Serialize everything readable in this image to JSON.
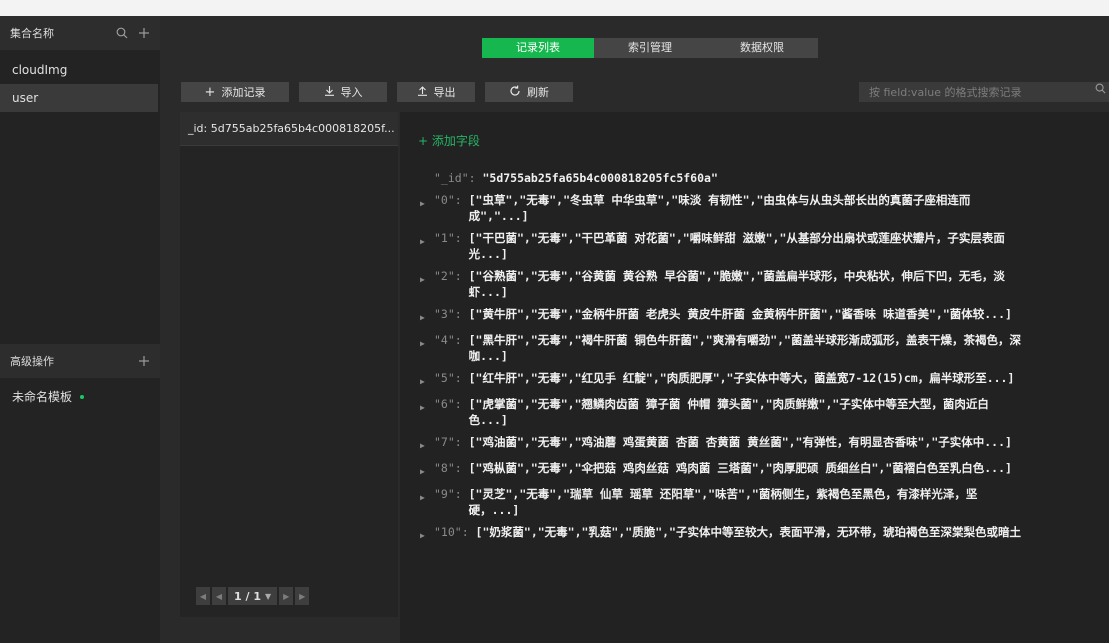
{
  "sidebar": {
    "collections_title": "集合名称",
    "collections": [
      {
        "name": "cloudImg",
        "active": false
      },
      {
        "name": "user",
        "active": true
      }
    ],
    "advanced_title": "高级操作",
    "template_name": "未命名模板"
  },
  "tabs": [
    {
      "label": "记录列表",
      "active": true
    },
    {
      "label": "索引管理",
      "active": false
    },
    {
      "label": "数据权限",
      "active": false
    }
  ],
  "toolbar": {
    "add_record": "添加记录",
    "import": "导入",
    "export": "导出",
    "refresh": "刷新"
  },
  "search": {
    "placeholder": "按 field:value 的格式搜索记录"
  },
  "records": [
    {
      "id": "_id: 5d755ab25fa65b4c000818205f..."
    }
  ],
  "pager": {
    "label": "1 / 1"
  },
  "detail": {
    "add_field": "添加字段",
    "id_key": "\"_id\": ",
    "id_value": "\"5d755ab25fa65b4c000818205fc5f60a\"",
    "fields": [
      {
        "key": "\"0\": ",
        "value": "[\"虫草\",\"无毒\",\"冬虫草 中华虫草\",\"味淡 有韧性\",\"由虫体与从虫头部长出的真菌子座相连而\n成\",\"...]"
      },
      {
        "key": "\"1\": ",
        "value": "[\"干巴菌\",\"无毒\",\"干巴革菌 对花菌\",\"嚼味鲜甜 滋嫩\",\"从基部分出扇状或莲座状瓣片，子实层表面\n光...]"
      },
      {
        "key": "\"2\": ",
        "value": "[\"谷熟菌\",\"无毒\",\"谷黄菌 黄谷熟 早谷菌\",\"脆嫩\",\"菌盖扁半球形，中央粘状，伸后下凹，无毛，淡\n虾...]"
      },
      {
        "key": "\"3\": ",
        "value": "[\"黄牛肝\",\"无毒\",\"金柄牛肝菌 老虎头 黄皮牛肝菌 金黄柄牛肝菌\",\"酱香味 味道香美\",\"菌体较...]"
      },
      {
        "key": "\"4\": ",
        "value": "[\"黑牛肝\",\"无毒\",\"褐牛肝菌 铜色牛肝菌\",\"爽滑有嚼劲\",\"菌盖半球形渐成弧形，盖表干燥，茶褐色，深\n咖...]"
      },
      {
        "key": "\"5\": ",
        "value": "[\"红牛肝\",\"无毒\",\"红见手 红靛\",\"肉质肥厚\",\"子实体中等大，菌盖宽7-12(15)cm，扁半球形至...]"
      },
      {
        "key": "\"6\": ",
        "value": "[\"虎掌菌\",\"无毒\",\"翘鳞肉齿菌 獐子菌 仲帽 獐头菌\",\"肉质鲜嫩\",\"子实体中等至大型，菌肉近白\n色...]"
      },
      {
        "key": "\"7\": ",
        "value": "[\"鸡油菌\",\"无毒\",\"鸡油蘑 鸡蛋黄菌 杏菌 杏黄菌 黄丝菌\",\"有弹性，有明显杏香味\",\"子实体中...]"
      },
      {
        "key": "\"8\": ",
        "value": "[\"鸡枞菌\",\"无毒\",\"伞把菇 鸡肉丝菇 鸡肉菌 三塔菌\",\"肉厚肥硕 质细丝白\",\"菌褶白色至乳白色...]"
      },
      {
        "key": "\"9\": ",
        "value": "[\"灵芝\",\"无毒\",\"瑞草 仙草 瑶草 还阳草\",\"味苦\",\"菌柄侧生，紫褐色至黑色，有漆样光泽，坚\n硬，...]"
      },
      {
        "key": "\"10\": ",
        "value": "[\"奶浆菌\",\"无毒\",\"乳菇\",\"质脆\",\"子实体中等至较大，表面平滑，无环带，琥珀褐色至深棠梨色或暗土"
      }
    ]
  }
}
